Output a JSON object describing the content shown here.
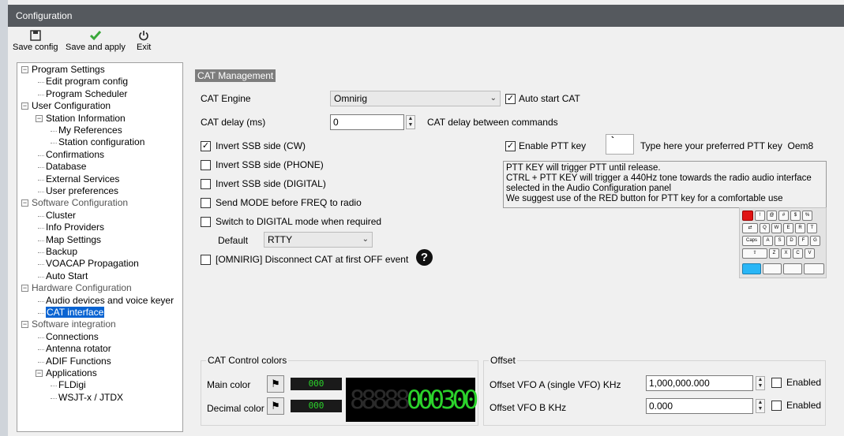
{
  "window": {
    "title": "Configuration"
  },
  "toolbar": {
    "save_config": {
      "label": "Save config",
      "icon": "floppy-icon"
    },
    "save_apply": {
      "label": "Save and apply",
      "icon": "checkmark-icon"
    },
    "exit": {
      "label": "Exit",
      "icon": "power-icon"
    }
  },
  "tree": [
    {
      "label": "Program Settings",
      "level": 0,
      "expanded": true
    },
    {
      "label": "Edit program config",
      "level": 1
    },
    {
      "label": "Program Scheduler",
      "level": 1
    },
    {
      "label": "User Configuration",
      "level": 0,
      "expanded": true
    },
    {
      "label": "Station Information",
      "level": 1,
      "expanded": true
    },
    {
      "label": "My References",
      "level": 2
    },
    {
      "label": "Station configuration",
      "level": 2
    },
    {
      "label": "Confirmations",
      "level": 1
    },
    {
      "label": "Database",
      "level": 1
    },
    {
      "label": "External Services",
      "level": 1
    },
    {
      "label": "User preferences",
      "level": 1
    },
    {
      "label": "Software Configuration",
      "level": 0,
      "expanded": true
    },
    {
      "label": "Cluster",
      "level": 1
    },
    {
      "label": "Info Providers",
      "level": 1
    },
    {
      "label": "Map Settings",
      "level": 1
    },
    {
      "label": "Backup",
      "level": 1
    },
    {
      "label": "VOACAP Propagation",
      "level": 1
    },
    {
      "label": "Auto Start",
      "level": 1
    },
    {
      "label": "Hardware Configuration",
      "level": 0,
      "expanded": true
    },
    {
      "label": "Audio devices and voice keyer",
      "level": 1
    },
    {
      "label": "CAT interface",
      "level": 1,
      "selected": true
    },
    {
      "label": "Software integration",
      "level": 0,
      "expanded": true
    },
    {
      "label": "Connections",
      "level": 1
    },
    {
      "label": "Antenna rotator",
      "level": 1
    },
    {
      "label": "ADIF Functions",
      "level": 1
    },
    {
      "label": "Applications",
      "level": 1,
      "expanded": true
    },
    {
      "label": "FLDigi",
      "level": 2
    },
    {
      "label": "WSJT-x / JTDX",
      "level": 2
    }
  ],
  "cat": {
    "header": "CAT Management",
    "engine_label": "CAT Engine",
    "engine_value": "Omnirig",
    "auto_start_label": "Auto start CAT",
    "auto_start_checked": true,
    "delay_label": "CAT delay (ms)",
    "delay_value": "0",
    "delay_desc": "CAT delay between commands",
    "invert_ssb_cw": {
      "label": "Invert SSB side (CW)",
      "checked": true
    },
    "invert_ssb_phone": {
      "label": "Invert SSB side (PHONE)",
      "checked": false
    },
    "invert_ssb_digital": {
      "label": "Invert SSB side (DIGITAL)",
      "checked": false
    },
    "send_mode": {
      "label": "Send MODE before FREQ to radio",
      "checked": false
    },
    "switch_digital": {
      "label": "Switch to DIGITAL mode when required",
      "checked": false
    },
    "default_label": "Default",
    "default_value": "RTTY",
    "omnirig_disconnect": {
      "label": "[OMNIRIG] Disconnect CAT at first OFF event",
      "checked": false
    },
    "enable_ptt": {
      "label": "Enable PTT key",
      "checked": true
    },
    "ptt_key_value": "`",
    "ptt_key_hint": "Type here your preferred PTT key",
    "ptt_key_name": "Oem8",
    "ptt_note": [
      "PTT KEY will trigger PTT until release.",
      "CTRL + PTT KEY will trigger a 440Hz tone towards the radio audio interface",
      "selected in the Audio Configuration panel",
      "We suggest use of the RED button for PTT key for a comfortable use"
    ]
  },
  "colors_group": {
    "title": "CAT Control colors",
    "main_label": "Main color",
    "main_value": "000",
    "decimal_label": "Decimal color",
    "decimal_value": "000",
    "display_digits": "88888000300",
    "main_color_hex": "#2bd22b",
    "decimal_color_hex": "#2bd22b"
  },
  "offset_group": {
    "title": "Offset",
    "vfo_a_label": "Offset VFO A (single VFO) KHz",
    "vfo_a_value": "1,000,000.000",
    "vfo_a_enabled_label": "Enabled",
    "vfo_a_enabled": false,
    "vfo_b_label": "Offset VFO B KHz",
    "vfo_b_value": "0.000",
    "vfo_b_enabled_label": "Enabled",
    "vfo_b_enabled": false
  },
  "accent_colors": {
    "selection": "#0a64d2",
    "titlebar": "#55595e",
    "ptt_red": "#e01414",
    "keyboard_blue": "#29b6f6"
  }
}
